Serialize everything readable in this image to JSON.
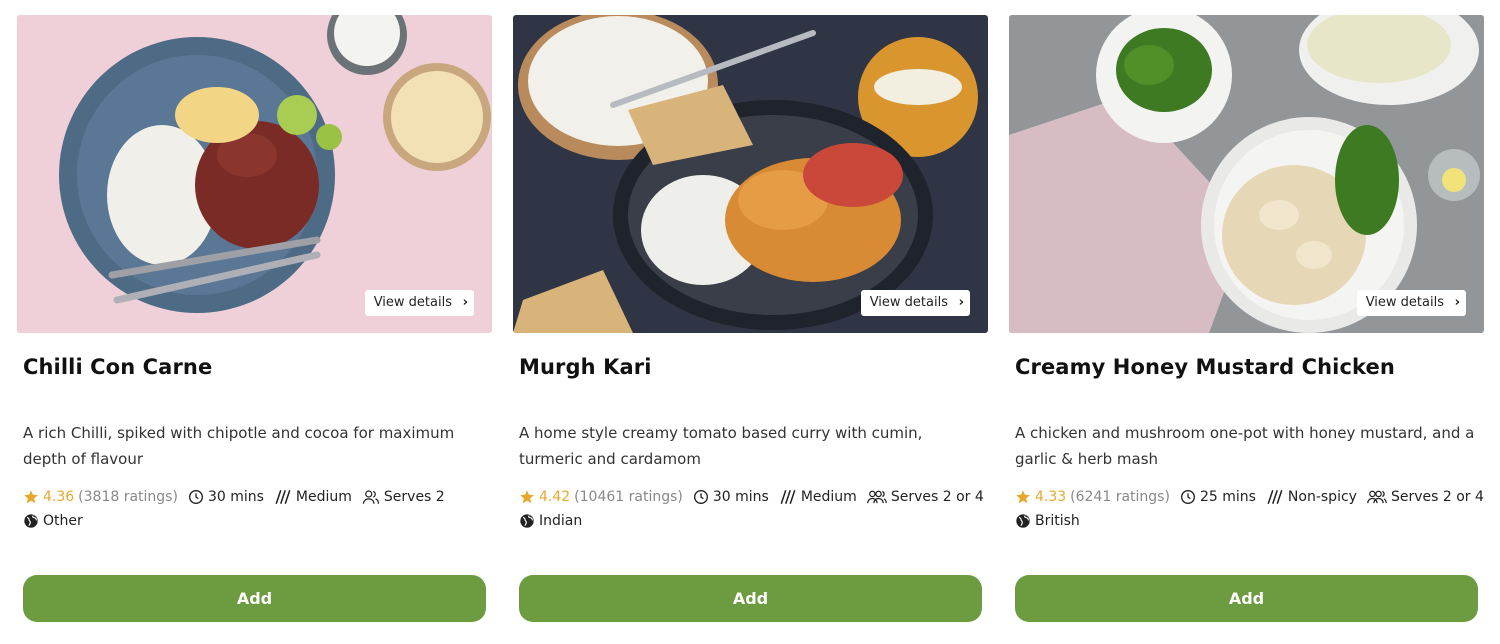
{
  "recipes": [
    {
      "title": "Chilli Con Carne",
      "description": "A rich Chilli, spiked with chipotle and cocoa for maximum depth of flavour",
      "rating": "4.36",
      "rating_count": "(3818 ratings)",
      "time": "30 mins",
      "spice": "Medium",
      "serves": "Serves 2",
      "cuisine": "Other",
      "view_details": "View details",
      "add_label": "Add",
      "image_colors": {
        "background": "#efd0d9",
        "plate": "#4e6b85"
      }
    },
    {
      "title": "Murgh Kari",
      "description": "A home style creamy tomato based curry with cumin, turmeric and cardamom",
      "rating": "4.42",
      "rating_count": "(10461 ratings)",
      "time": "30 mins",
      "spice": "Medium",
      "serves": "Serves 2 or 4",
      "cuisine": "Indian",
      "view_details": "View details",
      "add_label": "Add",
      "image_colors": {
        "background": "#2f3544",
        "plate": "#3a3e48"
      }
    },
    {
      "title": "Creamy Honey Mustard Chicken",
      "description": "A chicken and mushroom one-pot with honey mustard, and a garlic & herb mash",
      "rating": "4.33",
      "rating_count": "(6241 ratings)",
      "time": "25 mins",
      "spice": "Non-spicy",
      "serves": "Serves 2 or 4",
      "cuisine": "British",
      "view_details": "View details",
      "add_label": "Add",
      "image_colors": {
        "background": "#8d9193",
        "plate": "#f4f4f2"
      }
    }
  ],
  "colors": {
    "accent": "#6d9b3f",
    "star": "#e8a82d"
  },
  "icons": [
    "star-icon",
    "clock-icon",
    "chili-icon",
    "people-icon",
    "globe-icon",
    "chevron-right-icon"
  ]
}
